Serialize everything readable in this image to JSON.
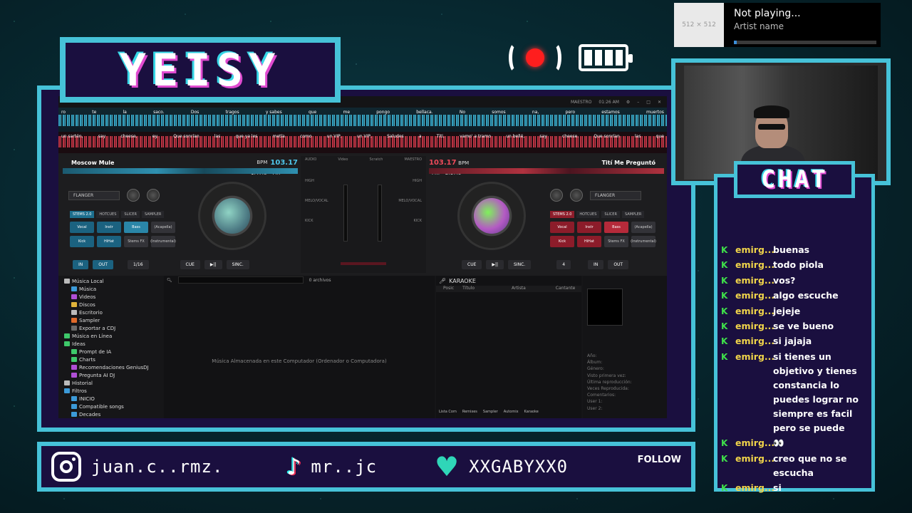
{
  "stream": {
    "logo": "YEISY",
    "chat_title": "CHAT"
  },
  "now_playing": {
    "art_placeholder": "512 × 512",
    "title": "Not playing...",
    "artist": "Artist name",
    "progress": 0.02
  },
  "dj": {
    "top_time": "01:26 AM",
    "top_label": "MAESTRO",
    "lyrics_top": [
      "ro",
      "te",
      "la",
      "saco.",
      "Dos",
      "tragos",
      "y sabes",
      "que",
      "me",
      "pongo",
      "bellaca.",
      "No",
      "somos",
      "na,",
      "pero",
      "estamos",
      "muertos"
    ],
    "lyrics_bottom": [
      "un sartén,",
      "say",
      "cheese,",
      "ey.",
      "Que sonrían",
      "las",
      "que ya les",
      "metía",
      "como",
      "un VIP,",
      "un VIP,",
      "Saludes",
      "a",
      "Titi,",
      "vamo' a tramo",
      "un bellé,",
      "say",
      "cheese.",
      "Que sonrían",
      "las",
      "que"
    ],
    "left": {
      "track": "Moscow Mule",
      "bpm": "103.17",
      "bpm_label": "BPM",
      "pitch": "1:47.6",
      "key": "Fm",
      "fx_label": "FLANGER",
      "pitch_pct": "+3.2%",
      "pad_tabs": [
        "STEMS 2.0",
        "HOTCUES",
        "SLICER",
        "SAMPLER"
      ],
      "pads": [
        "Vocal",
        "Instr",
        "Bass",
        "(Acapella)",
        "Kick",
        "HiHat",
        "Stems FX",
        "(Instrumental)"
      ],
      "loop_size": "1/16",
      "transport": [
        "IN",
        "OUT",
        "CUE",
        "▶||",
        "SINC."
      ]
    },
    "right": {
      "track": "Tití Me Preguntó",
      "bpm": "103.17",
      "bpm_label": "BPM",
      "pitch": "2:17.6",
      "key": "Fm",
      "fx_label": "FLANGER",
      "pitch_pct": "-6.5%",
      "pad_tabs": [
        "STEMS 2.0",
        "HOTCUES",
        "SLICER",
        "SAMPLER"
      ],
      "pads": [
        "Vocal",
        "Instr",
        "Bass",
        "(Acapella)",
        "Kick",
        "HiHat",
        "Stems FX",
        "(Instrumental)"
      ],
      "loop_size": "4",
      "transport": [
        "CUE",
        "▶||",
        "SINC.",
        "IN",
        "OUT"
      ]
    },
    "mixer_labels": [
      "AUDIO",
      "Video",
      "Scratch",
      "MAESTRO"
    ],
    "eq_labels": [
      "HIGH",
      "MELO/VOCAL",
      "KICK",
      "HIGH"
    ],
    "browser": {
      "tree": [
        {
          "label": "Música Local",
          "icon": "folder-icon",
          "color": "#bbbbbb",
          "indent": 0
        },
        {
          "label": "Música",
          "icon": "music-icon",
          "color": "#3c9ad8",
          "indent": 1
        },
        {
          "label": "Videos",
          "icon": "video-icon",
          "color": "#b04fd6",
          "indent": 1
        },
        {
          "label": "Discos",
          "icon": "disc-icon",
          "color": "#e0b33a",
          "indent": 1
        },
        {
          "label": "Escritorio",
          "icon": "desktop-icon",
          "color": "#bbbbbb",
          "indent": 1
        },
        {
          "label": "Sampler",
          "icon": "sampler-icon",
          "color": "#e06a2a",
          "indent": 1
        },
        {
          "label": "Exportar a CDJ",
          "icon": "export-icon",
          "color": "#6a6a6a",
          "indent": 1
        },
        {
          "label": "Música en Línea",
          "icon": "online-icon",
          "color": "#3ec96a",
          "indent": 0
        },
        {
          "label": "Ideas",
          "icon": "ideas-icon",
          "color": "#3ec96a",
          "indent": 0
        },
        {
          "label": "Prompt de IA",
          "icon": "ai-icon",
          "color": "#3ec96a",
          "indent": 1
        },
        {
          "label": "Charts",
          "icon": "chart-icon",
          "color": "#3ec96a",
          "indent": 1
        },
        {
          "label": "Recomendaciones GeniusDJ",
          "icon": "genius-icon",
          "color": "#b04fd6",
          "indent": 1
        },
        {
          "label": "Pregunta AI DJ",
          "icon": "ask-icon",
          "color": "#b04fd6",
          "indent": 1
        },
        {
          "label": "Historial",
          "icon": "history-icon",
          "color": "#bbbbbb",
          "indent": 0
        },
        {
          "label": "Filtros",
          "icon": "filter-icon",
          "color": "#3c9ad8",
          "indent": 0
        },
        {
          "label": "INICIO",
          "icon": "home-icon",
          "color": "#3c9ad8",
          "indent": 1
        },
        {
          "label": "Compatible songs",
          "icon": "compatible-icon",
          "color": "#3c9ad8",
          "indent": 1
        },
        {
          "label": "Decades",
          "icon": "decades-icon",
          "color": "#3c9ad8",
          "indent": 1
        }
      ],
      "files_count": "0 archivos",
      "files_message": "Música Almacenada en este Computador (Ordenador o Computadora)",
      "karaoke_title": "KARAOKE",
      "karaoke_columns": [
        "Posic",
        "Título",
        "Artista",
        "Cantante"
      ],
      "karaoke_tabs": [
        "Lista Com",
        "Remixes",
        "Sampler",
        "Automix",
        "Karaoke"
      ],
      "info_fields": [
        "Año:",
        "Álbum:",
        "Género:",
        "Visto primera vez:",
        "Última reproducción:",
        "Veces Reproducida:",
        "Comentarios:",
        "User 1:",
        "User 2:"
      ]
    }
  },
  "chat": {
    "messages": [
      {
        "user": "emirg...",
        "text": "buenas"
      },
      {
        "user": "emirg...",
        "text": "todo piola"
      },
      {
        "user": "emirg...",
        "text": "vos?"
      },
      {
        "user": "emirg...",
        "text": "algo escuche"
      },
      {
        "user": "emirg...",
        "text": "jejeje"
      },
      {
        "user": "emirg...",
        "text": "se ve bueno"
      },
      {
        "user": "emirg...",
        "text": "si jajaja"
      },
      {
        "user": "emirg...",
        "text": "si tienes un objetivo y tienes constancia lo puedes lograr no siempre es facil pero se puede"
      },
      {
        "user": "emirg...",
        "text": "👀"
      },
      {
        "user": "emirg...",
        "text": "creo que no se escucha"
      },
      {
        "user": "emirg...",
        "text": "si"
      }
    ]
  },
  "social": {
    "instagram": "juan.c..rmz.",
    "tiktok": "mr..jc",
    "heart_handle": "XXGABYXX0",
    "follow": "FOLLOW"
  }
}
